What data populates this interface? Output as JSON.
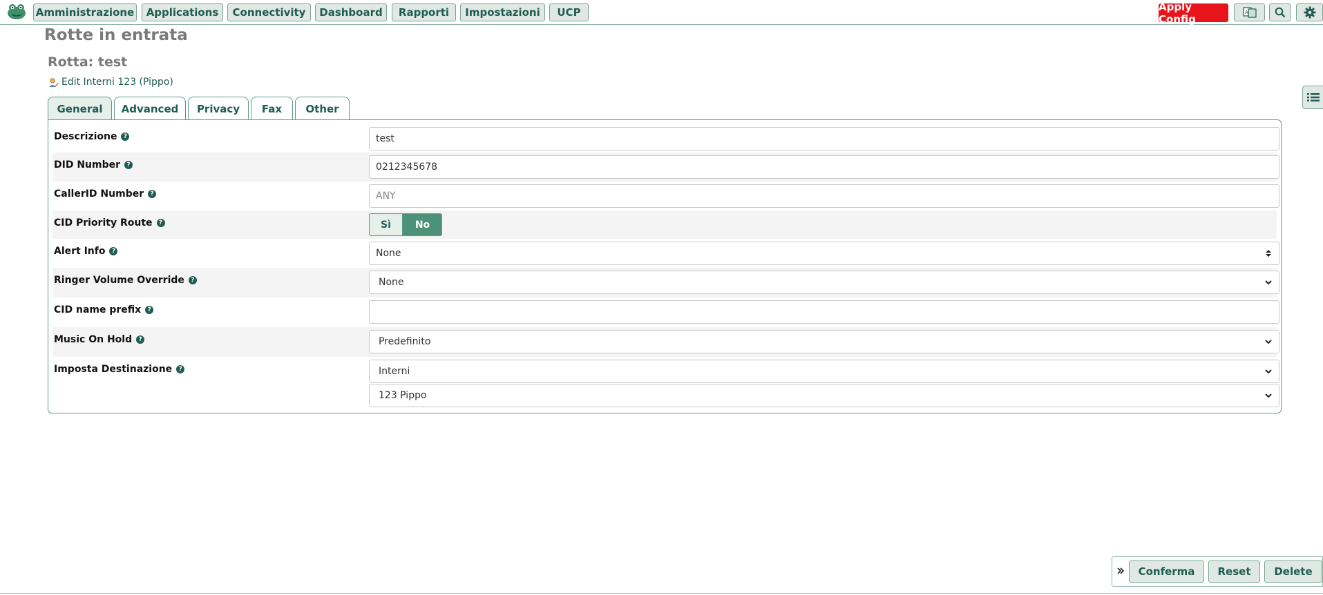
{
  "nav": {
    "items": [
      "Amministrazione",
      "Applications",
      "Connectivity",
      "Dashboard",
      "Rapporti",
      "Impostazioni",
      "UCP"
    ],
    "apply_label": "Apply Config"
  },
  "page": {
    "title": "Rotte in entrata",
    "subtitle": "Rotta: test",
    "edit_link": "Edit Interni 123 (Pippo)"
  },
  "tabs": [
    "General",
    "Advanced",
    "Privacy",
    "Fax",
    "Other"
  ],
  "form": {
    "descrizione": {
      "label": "Descrizione",
      "value": "test"
    },
    "did": {
      "label": "DID Number",
      "value": "0212345678"
    },
    "callerid": {
      "label": "CallerID Number",
      "placeholder": "ANY"
    },
    "cid_priority": {
      "label": "CID Priority Route",
      "yes": "Sì",
      "no": "No",
      "selected": "No"
    },
    "alert_info": {
      "label": "Alert Info",
      "value": "None"
    },
    "ringer": {
      "label": "Ringer Volume Override",
      "value": "None"
    },
    "cid_prefix": {
      "label": "CID name prefix",
      "value": ""
    },
    "moh": {
      "label": "Music On Hold",
      "value": "Predefinito"
    },
    "destination": {
      "label": "Imposta Destinazione",
      "type": "Interni",
      "target": "123 Pippo"
    }
  },
  "actions": {
    "confirm": "Conferma",
    "reset": "Reset",
    "delete": "Delete"
  },
  "colors": {
    "accent": "#1f5c52",
    "apply": "#e8141b",
    "toggle_on": "#4c9278"
  }
}
